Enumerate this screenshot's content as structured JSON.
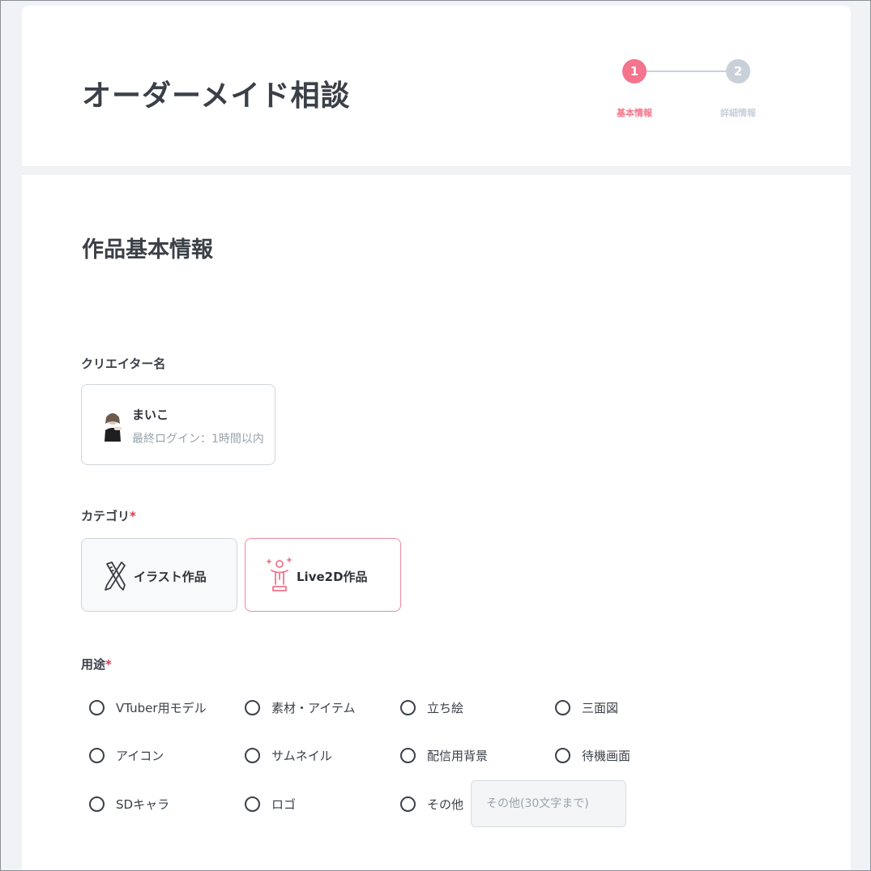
{
  "header": {
    "title": "オーダーメイド相談",
    "steps": [
      {
        "number": "1",
        "label": "基本情報",
        "state": "active",
        "color": "#f3748c"
      },
      {
        "number": "2",
        "label": "詳細情報",
        "state": "inactive",
        "color": "#c9d0da"
      }
    ]
  },
  "form": {
    "section_title": "作品基本情報",
    "creator": {
      "label": "クリエイター名",
      "name": "まいこ",
      "last_login": "最終ログイン：1時間以内"
    },
    "category": {
      "label": "カテゴリ",
      "required_mark": "*",
      "options": [
        {
          "label": "イラスト作品",
          "icon": "pen-ruler-icon",
          "selected": false
        },
        {
          "label": "Live2D作品",
          "icon": "live2d-figure-icon",
          "selected": true
        }
      ]
    },
    "usage": {
      "label": "用途",
      "required_mark": "*",
      "options": [
        {
          "label": "VTuber用モデル",
          "checked": false
        },
        {
          "label": "素材・アイテム",
          "checked": false
        },
        {
          "label": "立ち絵",
          "checked": false
        },
        {
          "label": "三面図",
          "checked": false
        },
        {
          "label": "アイコン",
          "checked": false
        },
        {
          "label": "サムネイル",
          "checked": false
        },
        {
          "label": "配信用背景",
          "checked": false
        },
        {
          "label": "待機画面",
          "checked": false
        },
        {
          "label": "SDキャラ",
          "checked": false
        },
        {
          "label": "ロゴ",
          "checked": false
        },
        {
          "label": "その他",
          "checked": false
        }
      ],
      "other_placeholder": "その他(30文字まで)",
      "other_value": ""
    }
  },
  "colors": {
    "accent": "#f3748c",
    "required": "#e0344d",
    "page_background": "#f0f2f5"
  }
}
